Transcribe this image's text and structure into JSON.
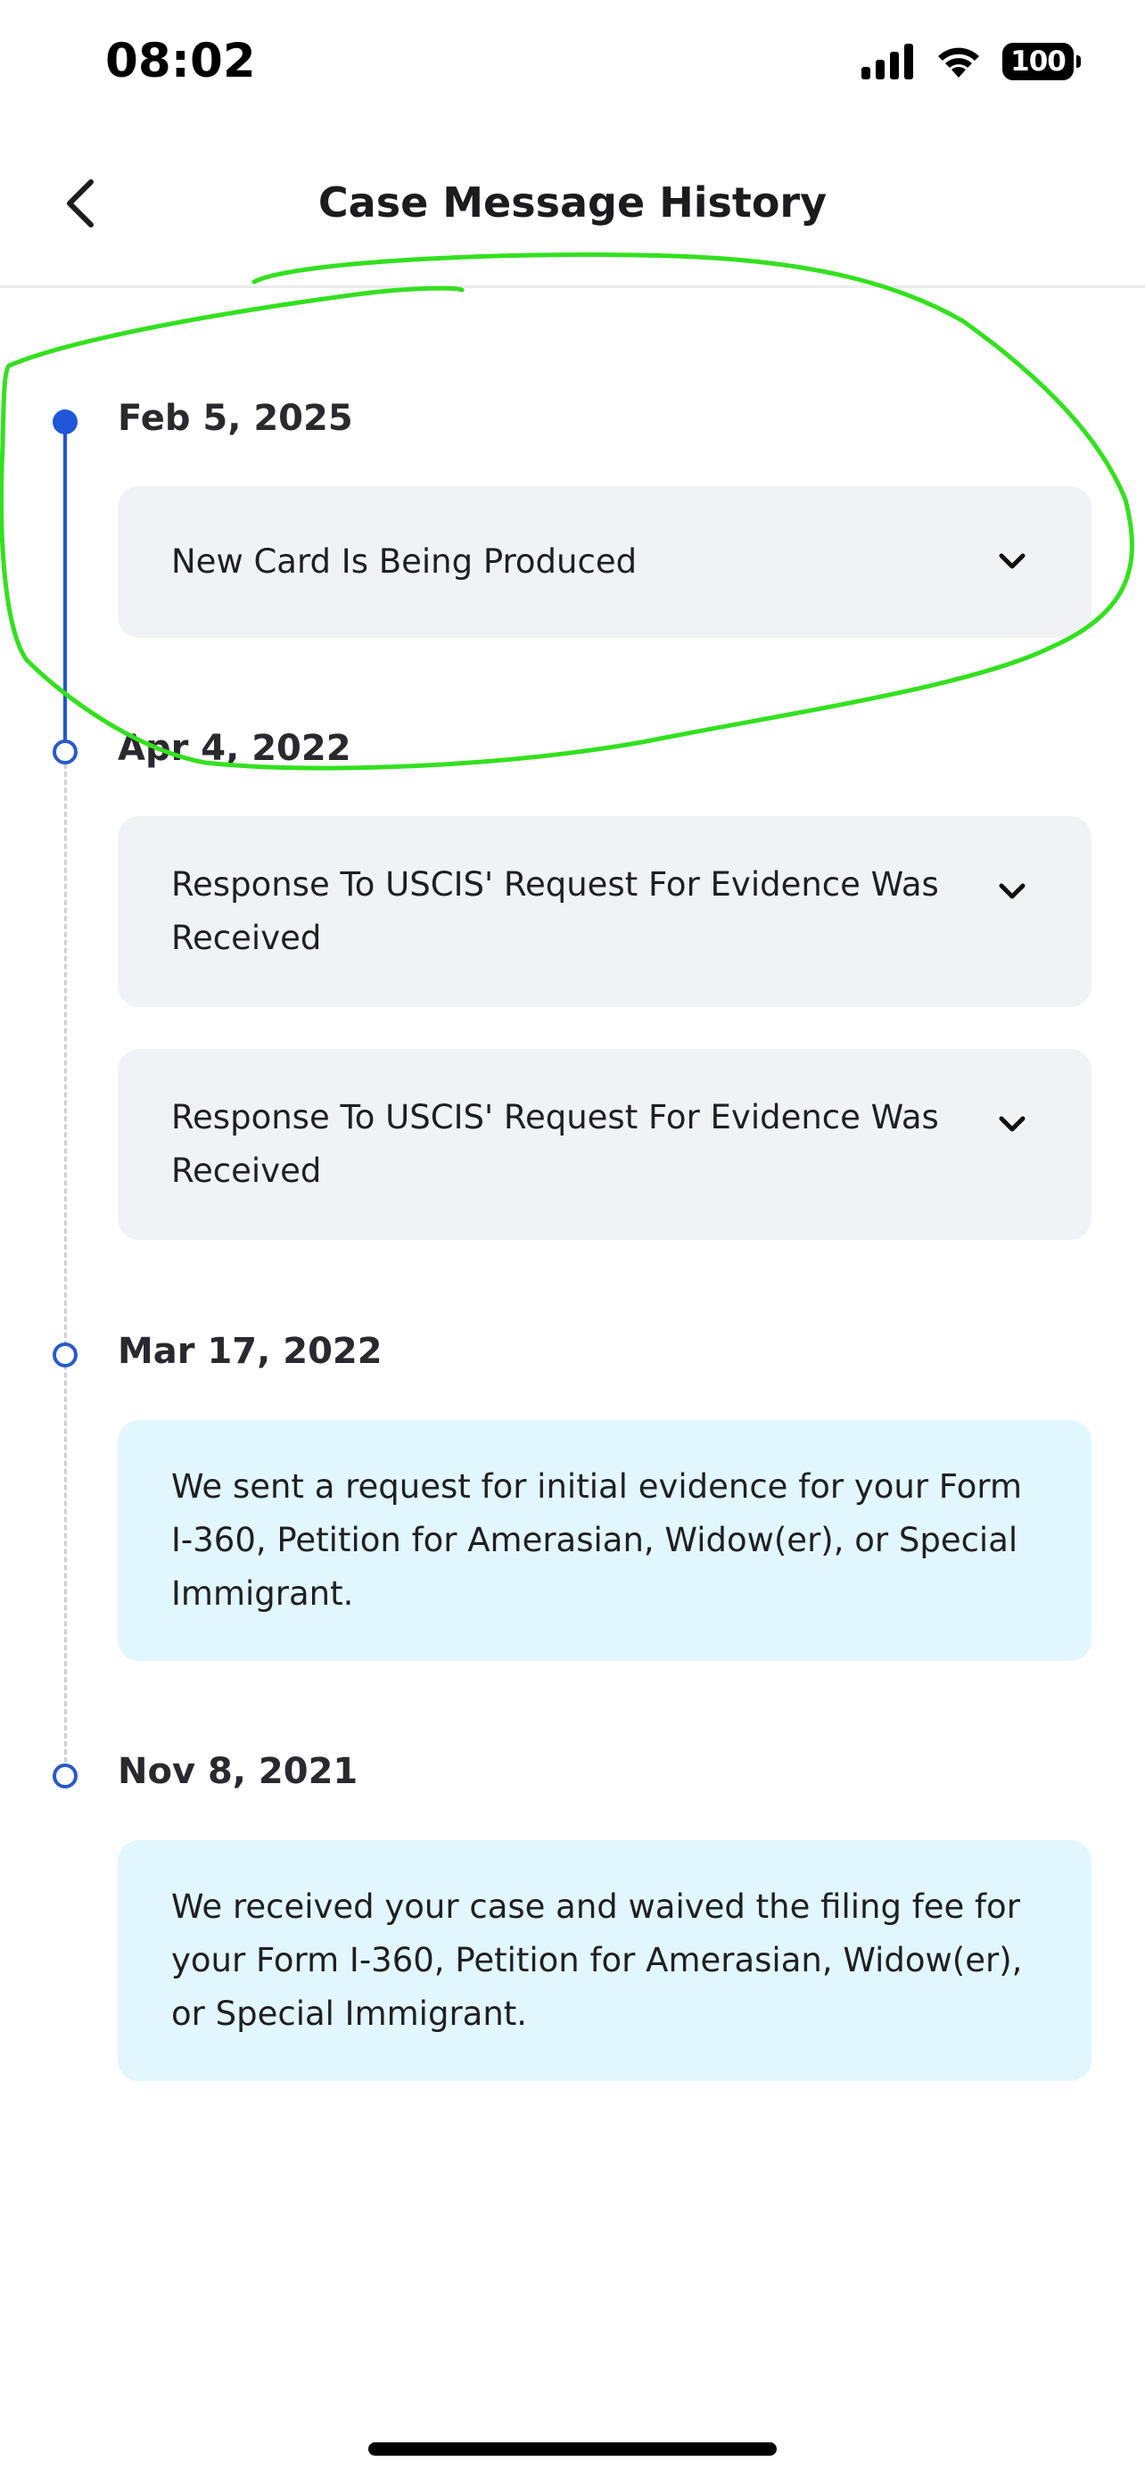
{
  "status_bar": {
    "time": "08:02",
    "battery": "100",
    "icons": [
      "cellular-signal-icon",
      "wifi-icon",
      "battery-icon"
    ]
  },
  "header": {
    "title": "Case Message History",
    "back_icon": "chevron-left-icon"
  },
  "timeline": [
    {
      "date": "Feb 5, 2025",
      "marker": "filled",
      "entries": [
        {
          "type": "collapsible",
          "text": "New Card Is Being Produced",
          "icon": "chevron-down-icon"
        }
      ]
    },
    {
      "date": "Apr 4, 2022",
      "marker": "open",
      "entries": [
        {
          "type": "collapsible",
          "text": "Response To USCIS' Request For Evidence Was Received",
          "icon": "chevron-down-icon"
        },
        {
          "type": "collapsible",
          "text": "Response To USCIS' Request For Evidence Was Received",
          "icon": "chevron-down-icon"
        }
      ]
    },
    {
      "date": "Mar 17, 2022",
      "marker": "open",
      "entries": [
        {
          "type": "message",
          "text": "We sent a request for initial evidence for your Form I-360, Petition for Amerasian, Widow(er), or Special Immigrant."
        }
      ]
    },
    {
      "date": "Nov 8, 2021",
      "marker": "open",
      "entries": [
        {
          "type": "message",
          "text": "We received your case and waived the filing fee for your Form I-360, Petition for Amerasian, Widow(er), or Special Immigrant."
        }
      ]
    }
  ],
  "colors": {
    "accent": "#1f56d8",
    "collapsible_card_bg": "#f1f2f5",
    "message_card_bg": "#e1f6fd",
    "annotation_stroke": "#33e01f"
  }
}
